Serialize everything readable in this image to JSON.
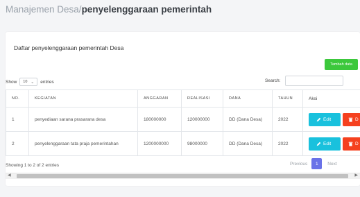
{
  "breadcrumb": {
    "parent": "Manajemen Desa/",
    "current": "penyelenggaraan pemerintah"
  },
  "card": {
    "title": "Daftar penyelenggaraan pemerintah Desa",
    "add_button": "Tambah data"
  },
  "controls": {
    "show_label": "Show",
    "page_size": "10",
    "entries_label": "entries",
    "search_label": "Search:",
    "search_value": ""
  },
  "table": {
    "headers": [
      "NO.",
      "KEGIATAN",
      "ANGGARAN",
      "REALISASI",
      "DANA",
      "TAHUN",
      "Aksi"
    ],
    "rows": [
      {
        "no": "1",
        "kegiatan": "penyediaan sarana prasarana desa",
        "anggaran": "180000000",
        "realisasi": "120000000",
        "dana": "DD (Dana Desa)",
        "tahun": "2022"
      },
      {
        "no": "2",
        "kegiatan": "penyelenggaraan tata praja pemerintahan",
        "anggaran": "1200000000",
        "realisasi": "98000000",
        "dana": "DD (Dana Desa)",
        "tahun": "2022"
      }
    ],
    "edit_label": "Edit",
    "delete_label": "D"
  },
  "footer": {
    "info": "Showing 1 to 2 of 2 entries",
    "prev": "Previous",
    "page": "1",
    "next": "Next"
  },
  "colors": {
    "add": "#3cc83c",
    "edit": "#19c1dd",
    "delete": "#f5411f",
    "page_active": "#6a72e8"
  },
  "icons": {
    "edit": "pencil-icon",
    "delete": "trash-icon"
  }
}
